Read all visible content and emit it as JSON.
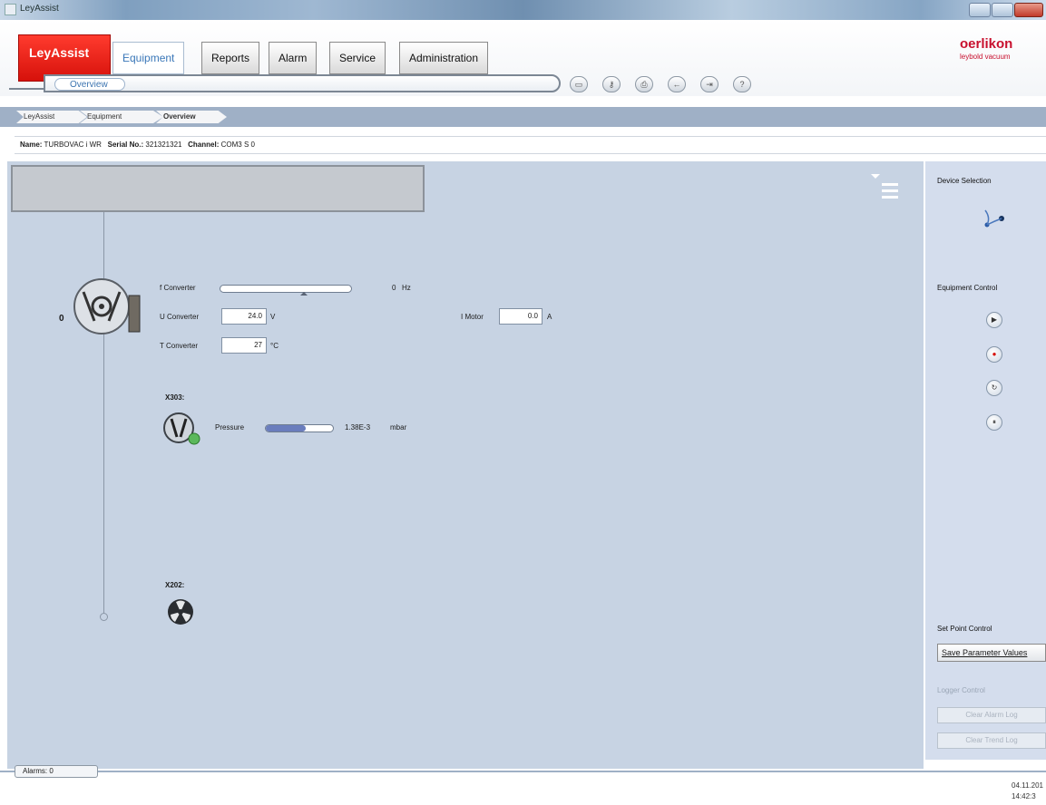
{
  "window": {
    "title": "LeyAssist"
  },
  "nav": {
    "home_tab": "LeyAssist",
    "tabs": [
      "Equipment",
      "Reports",
      "Alarm",
      "Service",
      "Administration"
    ],
    "sub_tab": "Overview"
  },
  "brand": {
    "name": "oerlikon",
    "sub": "leybold vacuum",
    "color": "#c8102e"
  },
  "breadcrumb": [
    "LeyAssist",
    "Equipment",
    "Overview"
  ],
  "info": {
    "name_label": "Name:",
    "name_value": "TURBOVAC i WR",
    "serial_label": "Serial No.:",
    "serial_value": "321321321",
    "channel_label": "Channel:",
    "channel_value": "COM3 S 0"
  },
  "device": {
    "index_label": "0",
    "f_converter_label": "f Converter",
    "f_converter_value": "0",
    "f_converter_unit": "Hz",
    "u_converter_label": "U Converter",
    "u_converter_value": "24.0",
    "u_converter_unit": "V",
    "t_converter_label": "T Converter",
    "t_converter_value": "27",
    "t_converter_unit": "°C",
    "i_motor_label": "I Motor",
    "i_motor_value": "0.0",
    "i_motor_unit": "A"
  },
  "gauge": {
    "port_label": "X303:",
    "pressure_label": "Pressure",
    "pressure_value": "1.38E-3",
    "pressure_unit": "mbar",
    "pressure_bar_fraction": 0.6
  },
  "fan": {
    "port_label": "X202:"
  },
  "right_panel": {
    "device_selection": "Device Selection",
    "equipment_control": "Equipment Control",
    "set_point_control": "Set Point Control",
    "save_button": "Save Parameter Values",
    "logger_control": "Logger Control",
    "clear_alarm_log": "Clear Alarm Log",
    "clear_trend_log": "Clear Trend Log"
  },
  "status": {
    "alarms": "Alarms: 0",
    "date": "04.11.201",
    "time": "14:42:3"
  },
  "colors": {
    "accent_red": "#d6110b",
    "accent_blue": "#3a77b8",
    "panel": "#c7d3e3"
  }
}
